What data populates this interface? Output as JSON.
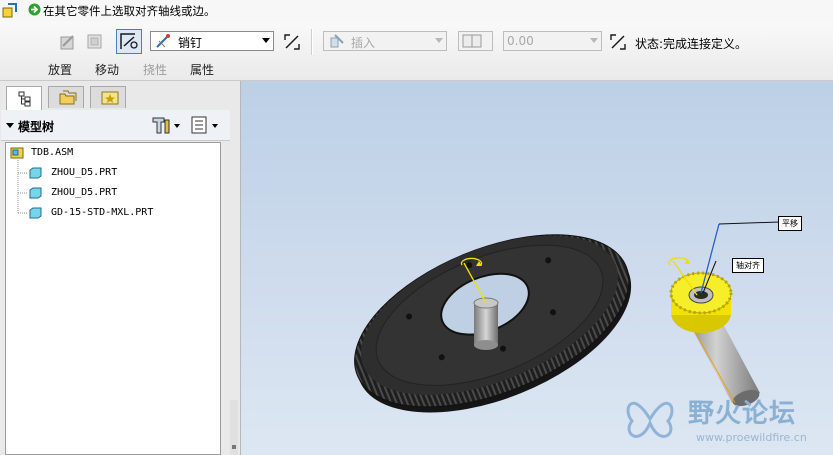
{
  "message": {
    "text": "在其它零件上选取对齐轴线或边。"
  },
  "dashboard": {
    "constraint_set": "销钉",
    "constraint_type": "插入",
    "offset_value": "0.00",
    "status_label": "状态:",
    "status_value": "完成连接定义。",
    "slideups": [
      "放置",
      "移动",
      "挠性",
      "属性"
    ]
  },
  "model_tree": {
    "title": "模型树",
    "root": "TDB.ASM",
    "items": [
      "ZHOU_D5.PRT",
      "ZHOU_D5.PRT",
      "GD-15-STD-MXL.PRT"
    ]
  },
  "graphics": {
    "annotation_translate": "平移",
    "annotation_axis_align": "轴对齐"
  },
  "watermark": {
    "text": "野火论坛",
    "url": "www.proewildfire.cn"
  },
  "colors": {
    "accent": "#4a7fbf",
    "gear_body": "#2a2a2a",
    "pinion_yellow": "#f2e200",
    "shaft_gray": "#a8a8a8"
  }
}
